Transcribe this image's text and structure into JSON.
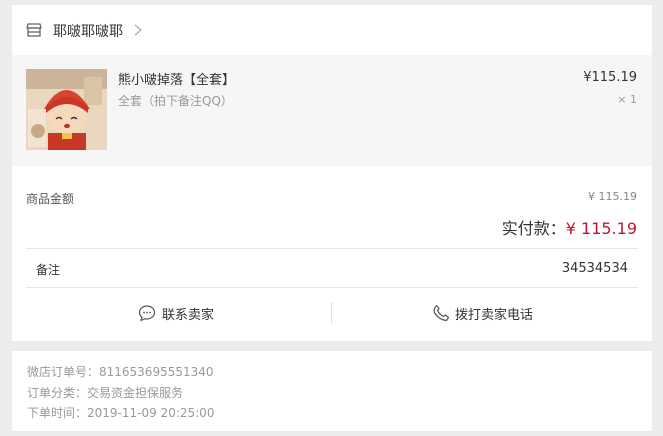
{
  "shop": {
    "name": "耶啵耶啵耶"
  },
  "product": {
    "title": "熊小啵掉落【全套】",
    "spec": "全套（拍下备注QQ）",
    "price": "¥115.19",
    "qty": "× 1"
  },
  "amounts": {
    "goods_label": "商品金额",
    "goods_value": "¥ 115.19",
    "paid_label": "实付款：",
    "paid_value": "¥ 115.19"
  },
  "note": {
    "label": "备注",
    "value": "34534534"
  },
  "actions": {
    "contact": "联系卖家",
    "call": "拨打卖家电话"
  },
  "order_info": {
    "order_no": "微店订单号：811653695551340",
    "category": "订单分类：交易资金担保服务",
    "time": "下单时间：2019-11-09 20:25:00"
  },
  "colors": {
    "accent": "#c8102e"
  }
}
